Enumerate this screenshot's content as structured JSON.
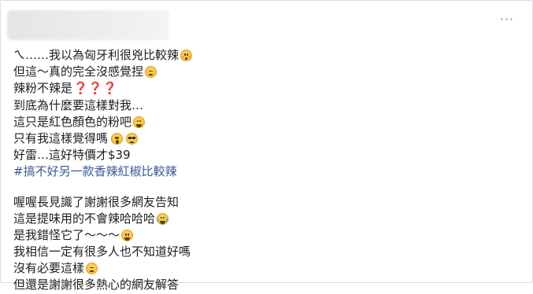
{
  "header": {
    "more_button": "···"
  },
  "post": {
    "lines": [
      {
        "text": "ㄟ……我以為匈牙利很兇比較辣",
        "emoji": "flushed"
      },
      {
        "text": "但這～真的完全沒感覺捏",
        "emoji": "expressionless"
      },
      {
        "text": "辣粉不辣是",
        "qmarks": "❓❓❓"
      },
      {
        "text": "到底為什麼要這樣對我…"
      },
      {
        "text": "這只是紅色顏色的粉吧",
        "emoji": "laugh"
      },
      {
        "text": "只有我這樣覺得嗎",
        "emoji2": [
          "astonished",
          "cool"
        ]
      },
      {
        "text": "好雷…這好特價才$39"
      },
      {
        "text": "#搞不好另一款香辣紅椒比較辣",
        "hashtag": true
      },
      {
        "text": "喔喔長見識了謝謝很多網友告知"
      },
      {
        "text": "這是提味用的不會辣哈哈哈",
        "emoji": "tear"
      },
      {
        "text": "是我錯怪它了～～～",
        "emoji": "grin"
      },
      {
        "text": "我相信一定有很多人也不知道好嗎"
      },
      {
        "text": "沒有必要這樣",
        "emoji": "expressionless"
      },
      {
        "text": "但還是謝謝很多熱心的網友解答"
      }
    ]
  },
  "colors": {
    "text": "#1c1e21",
    "hashtag": "#385898",
    "border": "#dadde1",
    "question_mark": "#e0245e"
  }
}
